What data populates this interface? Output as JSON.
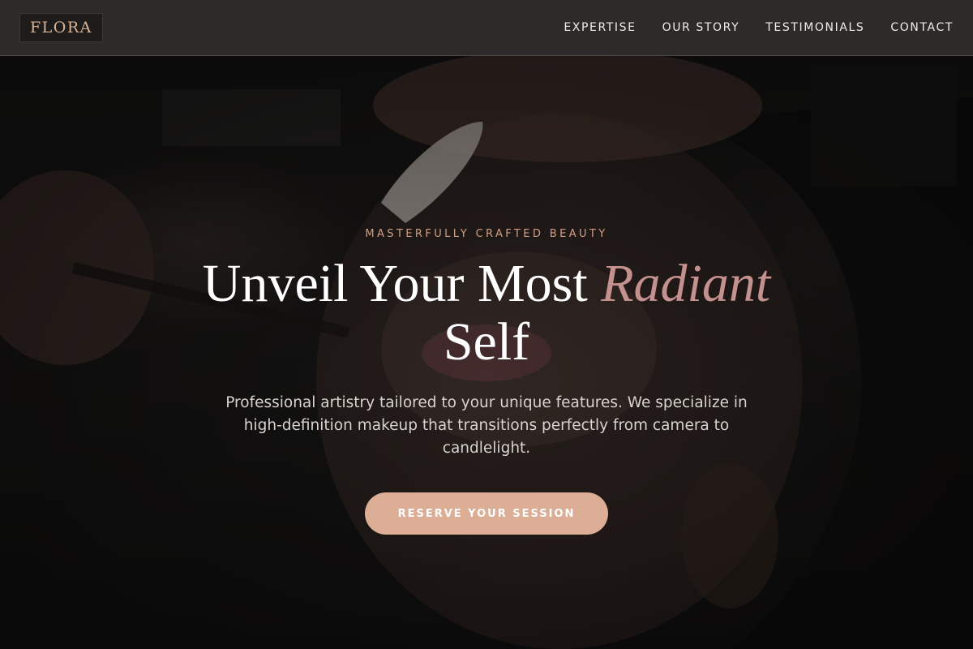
{
  "brand": {
    "logo_text": "FLORA",
    "accent": "#ddae96",
    "accent_text": "#c4918f"
  },
  "nav": {
    "items": [
      {
        "label": "EXPERTISE"
      },
      {
        "label": "OUR STORY"
      },
      {
        "label": "TESTIMONIALS"
      },
      {
        "label": "CONTACT"
      }
    ]
  },
  "hero": {
    "eyebrow": "MASTERFULLY CRAFTED BEAUTY",
    "title_part1": "Unveil Your Most ",
    "title_highlight": "Radiant",
    "title_part2": "Self",
    "subtitle": "Professional artistry tailored to your unique features. We specialize in high-definition makeup that transitions perfectly from camera to candlelight.",
    "cta_label": "RESERVE YOUR SESSION",
    "background_image": "makeup-artist-applying-eyeliner-photo"
  }
}
